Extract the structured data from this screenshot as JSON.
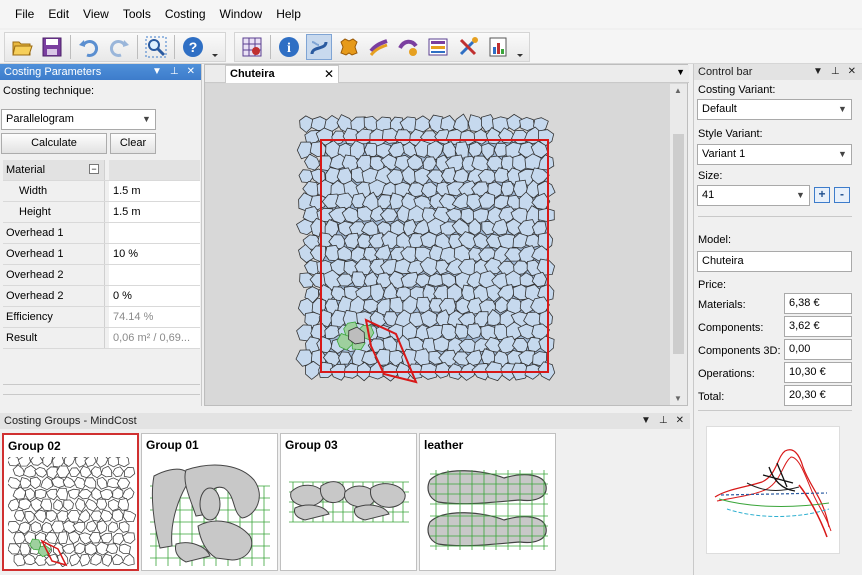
{
  "menu": [
    "File",
    "Edit",
    "View",
    "Tools",
    "Costing",
    "Window",
    "Help"
  ],
  "toolbar_icons": [
    "open-folder-icon",
    "save-icon",
    "undo-icon",
    "redo-icon",
    "zoom-icon",
    "help-icon",
    "grid-icon",
    "info-icon",
    "nesting-icon",
    "leather-icon",
    "layers-icon",
    "parts-icon",
    "list-icon",
    "tools-icon",
    "report-icon"
  ],
  "left_panel": {
    "title": "Costing Parameters",
    "technique_label": "Costing technique:",
    "technique_value": "Parallelogram",
    "calculate": "Calculate",
    "clear": "Clear",
    "rows": [
      {
        "key": "Material",
        "value": ""
      },
      {
        "key": "Width",
        "value": "1.5 m"
      },
      {
        "key": "Height",
        "value": "1.5 m"
      },
      {
        "key": "Overhead 1",
        "value": ""
      },
      {
        "key": "Overhead 1",
        "value": "10 %"
      },
      {
        "key": "Overhead 2",
        "value": ""
      },
      {
        "key": "Overhead 2",
        "value": "0 %"
      },
      {
        "key": "Efficiency",
        "value": "74.14 %"
      },
      {
        "key": "Result",
        "value": "0,06 m² / 0,69..."
      }
    ]
  },
  "document": {
    "tab": "Chuteira",
    "close": "✕"
  },
  "right_panel": {
    "title": "Control bar",
    "costing_variant_label": "Costing Variant:",
    "costing_variant": "Default",
    "style_variant_label": "Style Variant:",
    "style_variant": "Variant 1",
    "size_label": "Size:",
    "size": "41",
    "plus": "+",
    "minus": "-",
    "model_label": "Model:",
    "model": "Chuteira",
    "price_label": "Price:",
    "prices": [
      {
        "label": "Materials:",
        "value": "6,38 €"
      },
      {
        "label": "Components:",
        "value": "3,62 €"
      },
      {
        "label": "Components 3D:",
        "value": "0,00"
      },
      {
        "label": "Operations:",
        "value": "10,30 €"
      },
      {
        "label": "Total:",
        "value": "20,30 €"
      }
    ]
  },
  "bottom": {
    "title": "Costing Groups - MindCost",
    "groups": [
      "Group 02",
      "Group 01",
      "Group 03",
      "leather"
    ]
  },
  "colors": {
    "panel_header": "#3d7ccb",
    "outline_red": "#d81818",
    "piece_fill": "#c6d9ee",
    "highlight_green": "#3aa53a"
  }
}
